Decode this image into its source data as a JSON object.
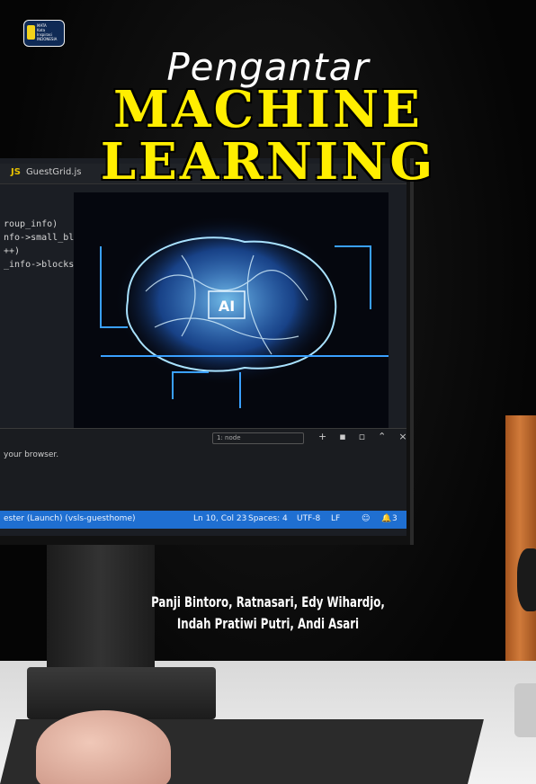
{
  "publisher_badge": {
    "text_lines": [
      "MATA",
      "Kata",
      "Inspirasi",
      "INDONESIA"
    ]
  },
  "cover": {
    "subtitle": "Pengantar",
    "title_line1": "MACHINE",
    "title_line2": "LEARNING",
    "authors_line1": "Panji Bintoro, Ratnasari, Edy Wihardjo,",
    "authors_line2": "Indah Pratiwi Putri, Andi Asari"
  },
  "screen": {
    "tab_lang": "JS",
    "tab_file": "GuestGrid.js",
    "code_lines": [
      "roup_info)",
      "",
      "nfo->small_block)",
      "",
      "++)",
      "_info->blocks[i]);"
    ],
    "ai_label": "AI",
    "panel_select": "1: node",
    "panel_text": "your browser.",
    "status": {
      "branch": "ester (Launch)  (vsls-guesthome)",
      "position": "Ln 10, Col 23",
      "spaces": "Spaces: 4",
      "encoding": "UTF-8",
      "eol": "LF",
      "notifications": "3"
    }
  },
  "colors": {
    "title_yellow": "#ffee00",
    "status_blue": "#1f6fd1",
    "badge_navy": "#0f2a55"
  }
}
